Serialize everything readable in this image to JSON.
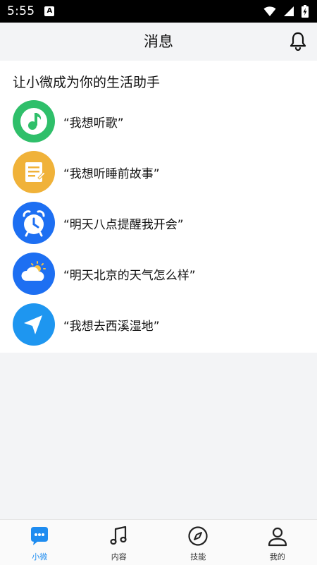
{
  "status_bar": {
    "time": "5:55",
    "notification_icon": "a-badge-icon",
    "icons": [
      "wifi-icon",
      "signal-icon",
      "battery-charging-icon"
    ]
  },
  "header": {
    "title": "消息",
    "right_icon": "bell-icon"
  },
  "card": {
    "title": "让小微成为你的生活助手",
    "items": [
      {
        "text": "“我想听歌”",
        "icon": "music-note-icon",
        "color": "#2fbf6a"
      },
      {
        "text": "“我想听睡前故事”",
        "icon": "story-document-icon",
        "color": "#f0b239"
      },
      {
        "text": "“明天八点提醒我开会”",
        "icon": "alarm-clock-icon",
        "color": "#1d6ff2"
      },
      {
        "text": "“明天北京的天气怎么样”",
        "icon": "weather-cloud-icon",
        "color": "#1d6ff2"
      },
      {
        "text": "“我想去西溪湿地”",
        "icon": "navigation-arrow-icon",
        "color": "#1e96f0"
      }
    ]
  },
  "bottom_nav": {
    "active_color": "#1e8cf0",
    "items": [
      {
        "label": "小微",
        "icon": "chat-bubble-icon",
        "active": true
      },
      {
        "label": "内容",
        "icon": "music-notes-icon",
        "active": false
      },
      {
        "label": "技能",
        "icon": "compass-icon",
        "active": false
      },
      {
        "label": "我的",
        "icon": "person-icon",
        "active": false
      }
    ]
  }
}
